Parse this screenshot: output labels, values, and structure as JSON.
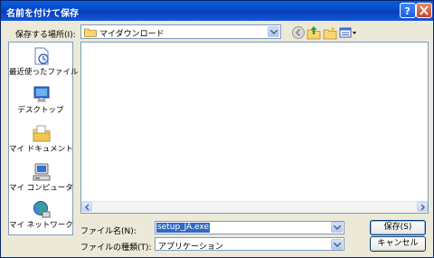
{
  "window": {
    "title": "名前を付けて保存"
  },
  "location": {
    "label": "保存する場所(I):",
    "value": "マイダウンロード"
  },
  "toolbar": {
    "icons": [
      "back-icon",
      "up-folder-icon",
      "new-folder-icon",
      "view-menu-icon"
    ]
  },
  "places": [
    {
      "name": "recent",
      "label": "最近使ったファイル",
      "icon": "recent-documents-icon"
    },
    {
      "name": "desktop",
      "label": "デスクトップ",
      "icon": "desktop-icon"
    },
    {
      "name": "my-documents",
      "label": "マイ ドキュメント",
      "icon": "my-documents-icon"
    },
    {
      "name": "my-computer",
      "label": "マイ コンピュータ",
      "icon": "my-computer-icon"
    },
    {
      "name": "my-network",
      "label": "マイ ネットワーク",
      "icon": "network-places-icon"
    }
  ],
  "filename": {
    "label": "ファイル名(N):",
    "value": "setup_JA.exe"
  },
  "filetype": {
    "label": "ファイルの種類(T):",
    "value": "アプリケーション"
  },
  "buttons": {
    "save": "保存(S)",
    "cancel": "キャンセル"
  },
  "colors": {
    "titlebar": "#0a4fd0",
    "dialog_bg": "#ece9d8",
    "selection": "#316ac5"
  }
}
